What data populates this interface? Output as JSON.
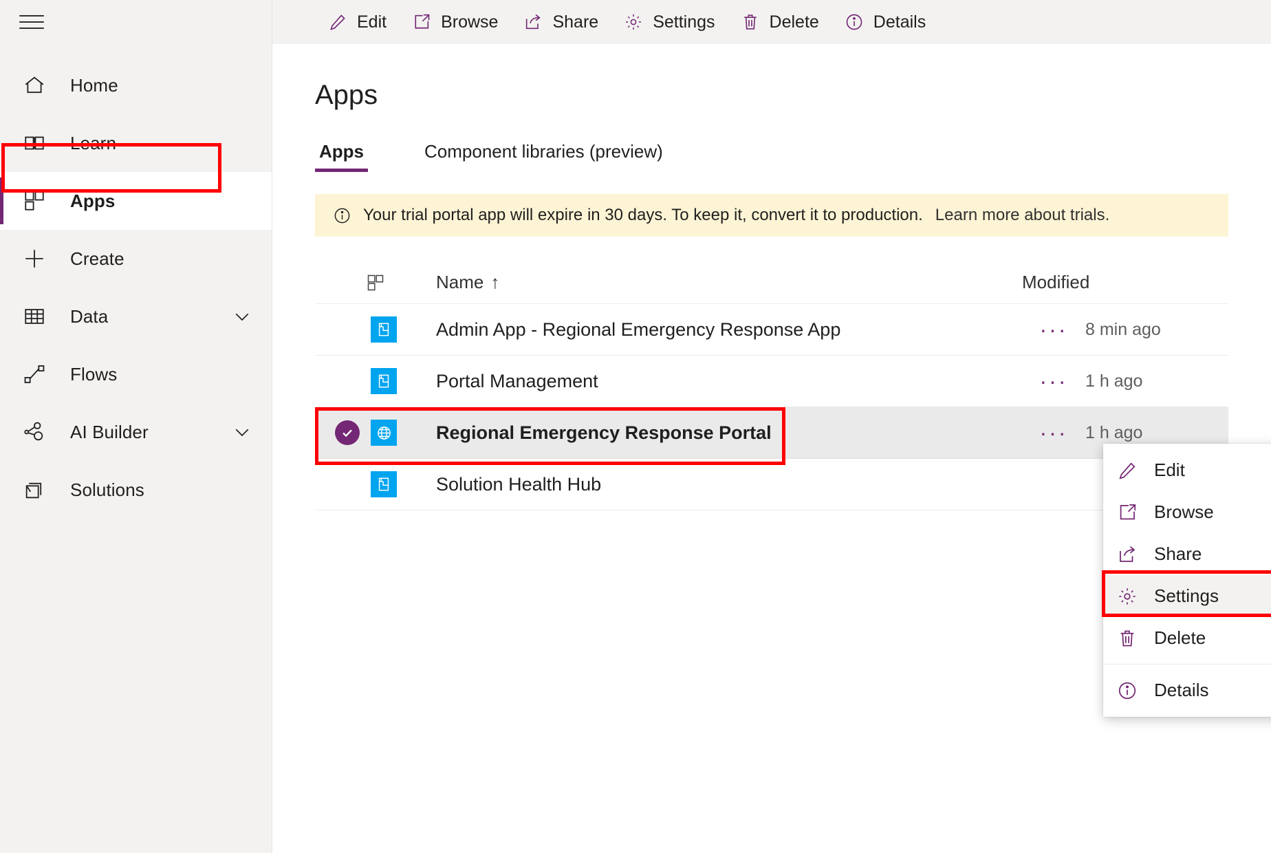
{
  "sidebar": {
    "menu_icon": "hamburger-icon",
    "items": [
      {
        "label": "Home",
        "icon": "home-icon",
        "selected": false,
        "expandable": false
      },
      {
        "label": "Learn",
        "icon": "book-icon",
        "selected": false,
        "expandable": false
      },
      {
        "label": "Apps",
        "icon": "apps-grid-icon",
        "selected": true,
        "expandable": false
      },
      {
        "label": "Create",
        "icon": "plus-icon",
        "selected": false,
        "expandable": false
      },
      {
        "label": "Data",
        "icon": "table-icon",
        "selected": false,
        "expandable": true
      },
      {
        "label": "Flows",
        "icon": "flow-icon",
        "selected": false,
        "expandable": false
      },
      {
        "label": "AI Builder",
        "icon": "ai-builder-icon",
        "selected": false,
        "expandable": true
      },
      {
        "label": "Solutions",
        "icon": "solutions-icon",
        "selected": false,
        "expandable": false
      }
    ]
  },
  "command_bar": {
    "items": [
      {
        "label": "Edit",
        "icon": "pencil-icon"
      },
      {
        "label": "Browse",
        "icon": "open-in-new-icon"
      },
      {
        "label": "Share",
        "icon": "share-icon"
      },
      {
        "label": "Settings",
        "icon": "gear-icon"
      },
      {
        "label": "Delete",
        "icon": "trash-icon"
      },
      {
        "label": "Details",
        "icon": "info-circle-icon"
      }
    ]
  },
  "page": {
    "title": "Apps",
    "tabs": [
      {
        "label": "Apps",
        "active": true
      },
      {
        "label": "Component libraries (preview)",
        "active": false
      }
    ]
  },
  "banner": {
    "icon": "info-circle-icon",
    "text": "Your trial portal app will expire in 30 days. To keep it, convert it to production.",
    "link": "Learn more about trials.",
    "background": "#fdf4d5"
  },
  "table": {
    "columns": {
      "icon": "apps-grid-icon",
      "name": "Name",
      "sort_indicator": "↑",
      "modified": "Modified"
    },
    "rows": [
      {
        "name": "Admin App - Regional Emergency Response App",
        "icon": "model-driven-app-icon",
        "modified": "8 min ago",
        "overflow": "···",
        "selected": false
      },
      {
        "name": "Portal Management",
        "icon": "model-driven-app-icon",
        "modified": "1 h ago",
        "overflow": "···",
        "selected": false
      },
      {
        "name": "Regional Emergency Response Portal",
        "icon": "globe-icon",
        "modified": "1 h ago",
        "overflow": "···",
        "selected": true
      },
      {
        "name": "Solution Health Hub",
        "icon": "model-driven-app-icon",
        "modified": "",
        "overflow": "",
        "selected": false
      }
    ]
  },
  "context_menu": {
    "items": [
      {
        "label": "Edit",
        "icon": "pencil-icon",
        "highlight": false
      },
      {
        "label": "Browse",
        "icon": "open-in-new-icon",
        "highlight": false
      },
      {
        "label": "Share",
        "icon": "share-icon",
        "highlight": false
      },
      {
        "label": "Settings",
        "icon": "gear-icon",
        "highlight": true
      },
      {
        "label": "Delete",
        "icon": "trash-icon",
        "highlight": false
      },
      {
        "label": "Details",
        "icon": "info-circle-icon",
        "highlight": false
      }
    ]
  },
  "colors": {
    "accent": "#742774",
    "app_tile": "#00a4ef",
    "annotation": "#ff0000",
    "banner_bg": "#fdf4d5",
    "sidebar_bg": "#f3f2f1",
    "selected_row_bg": "#eaeaea"
  }
}
